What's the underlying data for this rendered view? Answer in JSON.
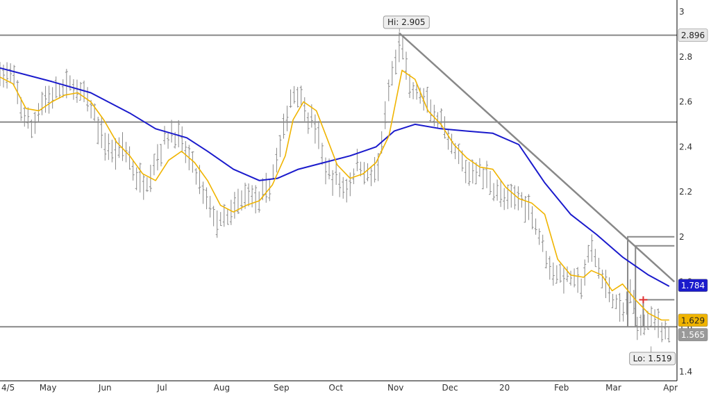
{
  "chart_data": {
    "type": "line",
    "title": "",
    "xlabel": "",
    "ylabel": "",
    "ylim": [
      1.4,
      3.05
    ],
    "y_ticks": [
      1.4,
      1.6,
      1.8,
      2,
      2.2,
      2.4,
      2.6,
      2.8,
      3
    ],
    "y_tick_labels": [
      "1.4",
      "1.6",
      "1.8",
      "2",
      "2.2",
      "2.4",
      "2.6",
      "2.8",
      "3"
    ],
    "x_labels": [
      {
        "label": "4/5",
        "t": 0
      },
      {
        "label": "May",
        "t": 18.5
      },
      {
        "label": "Jun",
        "t": 40.5
      },
      {
        "label": "Jul",
        "t": 62.5
      },
      {
        "label": "Aug",
        "t": 85.5
      },
      {
        "label": "Sep",
        "t": 108.5
      },
      {
        "label": "Oct",
        "t": 129.5
      },
      {
        "label": "Nov",
        "t": 152.5
      },
      {
        "label": "Dec",
        "t": 173.5
      },
      {
        "label": "20",
        "t": 194.5
      },
      {
        "label": "Feb",
        "t": 216.5
      },
      {
        "label": "Mar",
        "t": 236.5
      },
      {
        "label": "Apr",
        "t": 258.5
      }
    ],
    "xlim": [
      0,
      261
    ],
    "grid": false,
    "colors": {
      "price": "#888888",
      "fast_ma": "#f0b400",
      "slow_ma": "#1a1acc",
      "levels": "#888888",
      "marker": "#e03030"
    },
    "series": [
      {
        "role": "slow_ma",
        "points": [
          [
            0,
            2.75
          ],
          [
            20,
            2.69
          ],
          [
            35,
            2.64
          ],
          [
            50,
            2.55
          ],
          [
            60,
            2.48
          ],
          [
            72,
            2.44
          ],
          [
            80,
            2.38
          ],
          [
            90,
            2.3
          ],
          [
            100,
            2.25
          ],
          [
            107,
            2.26
          ],
          [
            115,
            2.3
          ],
          [
            125,
            2.33
          ],
          [
            135,
            2.36
          ],
          [
            145,
            2.4
          ],
          [
            152,
            2.47
          ],
          [
            160,
            2.5
          ],
          [
            170,
            2.48
          ],
          [
            180,
            2.47
          ],
          [
            190,
            2.46
          ],
          [
            200,
            2.41
          ],
          [
            210,
            2.24
          ],
          [
            220,
            2.1
          ],
          [
            230,
            2.01
          ],
          [
            240,
            1.91
          ],
          [
            250,
            1.83
          ],
          [
            258,
            1.78
          ]
        ]
      },
      {
        "role": "fast_ma",
        "points": [
          [
            0,
            2.71
          ],
          [
            5,
            2.68
          ],
          [
            10,
            2.57
          ],
          [
            15,
            2.56
          ],
          [
            20,
            2.6
          ],
          [
            25,
            2.63
          ],
          [
            30,
            2.64
          ],
          [
            35,
            2.6
          ],
          [
            40,
            2.52
          ],
          [
            45,
            2.42
          ],
          [
            50,
            2.36
          ],
          [
            55,
            2.28
          ],
          [
            60,
            2.25
          ],
          [
            65,
            2.34
          ],
          [
            70,
            2.38
          ],
          [
            75,
            2.33
          ],
          [
            80,
            2.25
          ],
          [
            85,
            2.14
          ],
          [
            90,
            2.11
          ],
          [
            95,
            2.14
          ],
          [
            100,
            2.16
          ],
          [
            105,
            2.23
          ],
          [
            110,
            2.36
          ],
          [
            113,
            2.52
          ],
          [
            117,
            2.6
          ],
          [
            122,
            2.56
          ],
          [
            126,
            2.44
          ],
          [
            130,
            2.32
          ],
          [
            135,
            2.26
          ],
          [
            140,
            2.28
          ],
          [
            145,
            2.33
          ],
          [
            150,
            2.45
          ],
          [
            155,
            2.74
          ],
          [
            160,
            2.7
          ],
          [
            165,
            2.56
          ],
          [
            170,
            2.5
          ],
          [
            175,
            2.41
          ],
          [
            180,
            2.35
          ],
          [
            185,
            2.31
          ],
          [
            190,
            2.3
          ],
          [
            195,
            2.22
          ],
          [
            200,
            2.17
          ],
          [
            205,
            2.15
          ],
          [
            210,
            2.1
          ],
          [
            215,
            1.9
          ],
          [
            220,
            1.83
          ],
          [
            225,
            1.82
          ],
          [
            228,
            1.85
          ],
          [
            232,
            1.83
          ],
          [
            236,
            1.76
          ],
          [
            240,
            1.79
          ],
          [
            245,
            1.72
          ],
          [
            250,
            1.66
          ],
          [
            255,
            1.63
          ],
          [
            258,
            1.63
          ]
        ]
      }
    ],
    "price_bars": {
      "anchors": [
        [
          0,
          2.73
        ],
        [
          5,
          2.7
        ],
        [
          9,
          2.55
        ],
        [
          12,
          2.47
        ],
        [
          16,
          2.6
        ],
        [
          20,
          2.62
        ],
        [
          24,
          2.66
        ],
        [
          28,
          2.67
        ],
        [
          32,
          2.63
        ],
        [
          36,
          2.55
        ],
        [
          40,
          2.42
        ],
        [
          44,
          2.37
        ],
        [
          48,
          2.41
        ],
        [
          52,
          2.27
        ],
        [
          56,
          2.23
        ],
        [
          60,
          2.34
        ],
        [
          64,
          2.44
        ],
        [
          68,
          2.46
        ],
        [
          72,
          2.37
        ],
        [
          76,
          2.27
        ],
        [
          80,
          2.15
        ],
        [
          84,
          2.06
        ],
        [
          88,
          2.08
        ],
        [
          92,
          2.15
        ],
        [
          96,
          2.2
        ],
        [
          100,
          2.15
        ],
        [
          104,
          2.23
        ],
        [
          108,
          2.4
        ],
        [
          112,
          2.61
        ],
        [
          115,
          2.66
        ],
        [
          118,
          2.55
        ],
        [
          122,
          2.48
        ],
        [
          126,
          2.28
        ],
        [
          130,
          2.25
        ],
        [
          134,
          2.21
        ],
        [
          138,
          2.33
        ],
        [
          142,
          2.27
        ],
        [
          146,
          2.31
        ],
        [
          150,
          2.65
        ],
        [
          153,
          2.8
        ],
        [
          155,
          2.87
        ],
        [
          158,
          2.65
        ],
        [
          162,
          2.63
        ],
        [
          166,
          2.56
        ],
        [
          170,
          2.51
        ],
        [
          173,
          2.4
        ],
        [
          176,
          2.37
        ],
        [
          180,
          2.28
        ],
        [
          184,
          2.3
        ],
        [
          188,
          2.26
        ],
        [
          192,
          2.2
        ],
        [
          196,
          2.15
        ],
        [
          200,
          2.18
        ],
        [
          204,
          2.13
        ],
        [
          208,
          2.01
        ],
        [
          212,
          1.87
        ],
        [
          216,
          1.82
        ],
        [
          220,
          1.82
        ],
        [
          224,
          1.78
        ],
        [
          228,
          1.95
        ],
        [
          232,
          1.82
        ],
        [
          236,
          1.74
        ],
        [
          240,
          1.64
        ],
        [
          243,
          1.76
        ],
        [
          246,
          1.6
        ],
        [
          249,
          1.63
        ],
        [
          252,
          1.64
        ],
        [
          255,
          1.6
        ],
        [
          258,
          1.57
        ]
      ],
      "spacing": 1.35,
      "range": 0.07,
      "seed": 7
    },
    "horizontal_levels": [
      2.896,
      2.51,
      1.6
    ],
    "trendline": {
      "from": [
        154,
        2.905
      ],
      "to": [
        260,
        1.8
      ]
    },
    "boxes": [
      {
        "t_start": 242,
        "t_end": 260,
        "y_high": 2.0
      },
      {
        "t_start": 245,
        "t_end": 260,
        "y_high": 1.96
      },
      {
        "t_start": 248,
        "t_end": 260,
        "y_high": 1.72
      }
    ],
    "marker": {
      "t": 248,
      "y": 1.72
    },
    "annotations": [
      {
        "text": "Hi: 2.905",
        "t": 154,
        "y": 2.905
      },
      {
        "text": "Lo: 1.519",
        "t": 251,
        "y": 1.519
      }
    ],
    "value_tags": [
      {
        "label": "2.896",
        "value": 2.896,
        "bg": "#e8e8e8",
        "fg": "#222222"
      },
      {
        "label": "1.784",
        "value": 1.784,
        "bg": "#1a1acc",
        "fg": "#ffffff"
      },
      {
        "label": "1.629",
        "value": 1.629,
        "bg": "#f0b400",
        "fg": "#222222"
      },
      {
        "label": "1.565",
        "value": 1.565,
        "bg": "#999999",
        "fg": "#ffffff"
      }
    ]
  }
}
